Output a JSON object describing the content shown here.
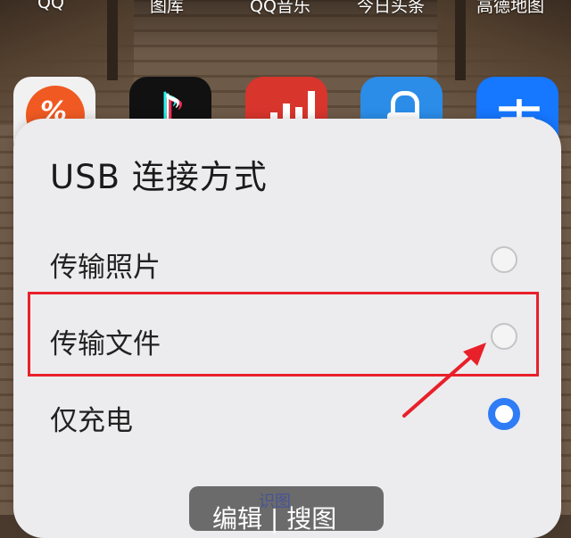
{
  "home_screen": {
    "app_labels": [
      "QQ",
      "图库",
      "QQ音乐",
      "今日头条",
      "高德地图"
    ],
    "app_icons": [
      "accounting-app-icon",
      "douyin-icon",
      "stock-app-icon",
      "unlock-app-icon",
      "alipay-icon"
    ],
    "alipay_glyph": "支",
    "douyin_glyph": "♪"
  },
  "dialog": {
    "title": "USB 连接方式",
    "options": [
      {
        "label": "传输照片",
        "selected": false
      },
      {
        "label": "传输文件",
        "selected": false
      },
      {
        "label": "仅充电",
        "selected": true
      }
    ],
    "accent_color": "#2f7cf6"
  },
  "annotation": {
    "highlight_color": "#e8202a",
    "arrow_color": "#e8202a"
  },
  "bottom_bar": {
    "button_text": "编辑 | 搜图",
    "watermark": "识图"
  }
}
